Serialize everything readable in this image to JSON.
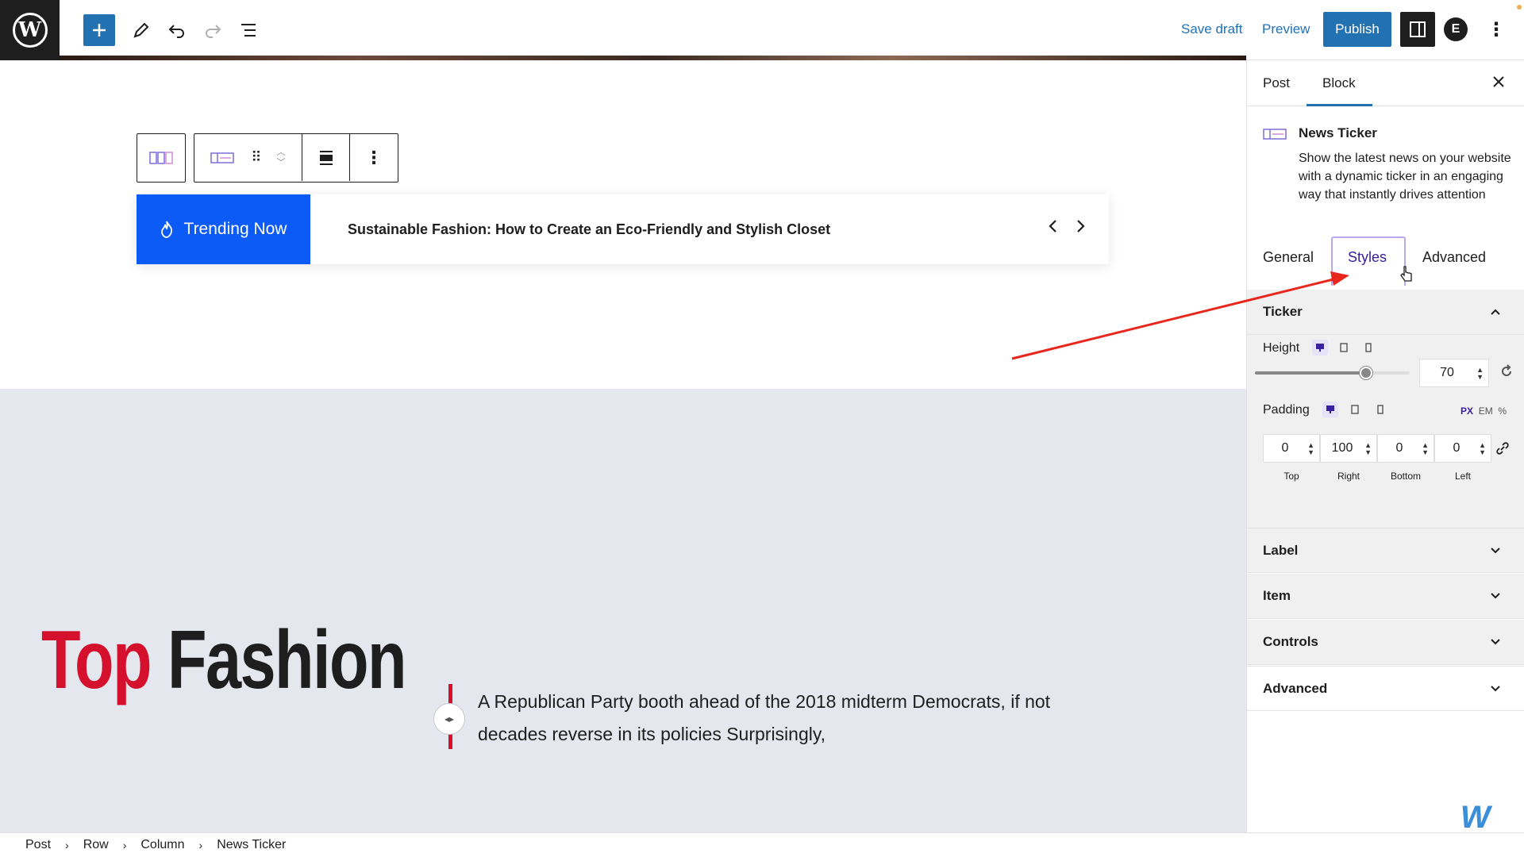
{
  "topbar": {
    "save_draft": "Save draft",
    "preview": "Preview",
    "publish": "Publish",
    "user_initial": "E"
  },
  "ticker": {
    "label": "Trending Now",
    "headline": "Sustainable Fashion: How to Create an Eco-Friendly and Stylish Closet"
  },
  "section": {
    "title_red": "Top",
    "title_black": "Fashion",
    "description": "A Republican Party booth ahead of the 2018 midterm Democrats, if not decades reverse in its policies Surprisingly,"
  },
  "sidebar": {
    "tabs": [
      "Post",
      "Block"
    ],
    "active_tab": "Block",
    "block": {
      "title": "News Ticker",
      "description": "Show the latest news on your website with a dynamic ticker in an engaging way that instantly drives attention"
    },
    "style_tabs": [
      "General",
      "Styles",
      "Advanced"
    ],
    "active_style_tab": "Styles",
    "panels": {
      "ticker": {
        "title": "Ticker",
        "height_label": "Height",
        "height_value": "70",
        "height_slider_fraction": 0.72,
        "padding_label": "Padding",
        "units": [
          "PX",
          "EM",
          "%"
        ],
        "active_unit": "PX",
        "padding": [
          {
            "label": "Top",
            "value": "0"
          },
          {
            "label": "Right",
            "value": "100"
          },
          {
            "label": "Bottom",
            "value": "0"
          },
          {
            "label": "Left",
            "value": "0"
          }
        ]
      },
      "label": "Label",
      "item": "Item",
      "controls": "Controls",
      "advanced": "Advanced"
    }
  },
  "breadcrumb": [
    "Post",
    "Row",
    "Column",
    "News Ticker"
  ],
  "colors": {
    "wp_blue": "#2271b1",
    "ticker_blue": "#0d5bf7",
    "fashion_red": "#d4102c",
    "accent_purple": "#3a20a0"
  }
}
